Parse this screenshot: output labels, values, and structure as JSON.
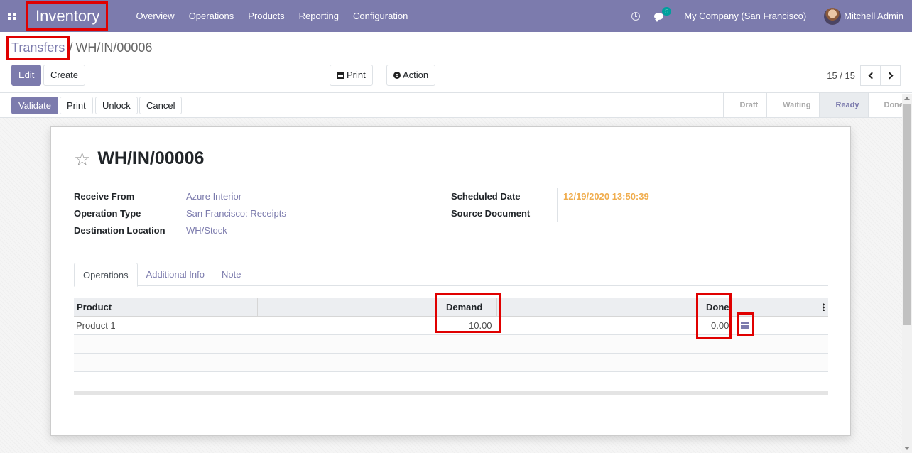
{
  "navbar": {
    "app_title": "Inventory",
    "menu": [
      "Overview",
      "Operations",
      "Products",
      "Reporting",
      "Configuration"
    ],
    "chat_badge": "5",
    "company": "My Company (San Francisco)",
    "user": "Mitchell Admin"
  },
  "breadcrumb": {
    "parent": "Transfers",
    "separator": "/",
    "current": "WH/IN/00006"
  },
  "toolbar": {
    "edit": "Edit",
    "create": "Create",
    "print": "Print",
    "action": "Action"
  },
  "pager": {
    "value": "15 / 15"
  },
  "statusbar": {
    "validate": "Validate",
    "print": "Print",
    "unlock": "Unlock",
    "cancel": "Cancel",
    "stages": [
      "Draft",
      "Waiting",
      "Ready",
      "Done"
    ],
    "active_stage": "Ready"
  },
  "record": {
    "title": "WH/IN/00006",
    "left_fields": [
      {
        "label": "Receive From",
        "value": "Azure Interior"
      },
      {
        "label": "Operation Type",
        "value": "San Francisco: Receipts"
      },
      {
        "label": "Destination Location",
        "value": "WH/Stock"
      }
    ],
    "right_fields": [
      {
        "label": "Scheduled Date",
        "value": "12/19/2020 13:50:39"
      },
      {
        "label": "Source Document",
        "value": ""
      }
    ]
  },
  "tabs": [
    "Operations",
    "Additional Info",
    "Note"
  ],
  "operations_table": {
    "headers": {
      "product": "Product",
      "demand": "Demand",
      "done": "Done"
    },
    "rows": [
      {
        "product": "Product 1",
        "demand": "10.00",
        "done": "0.00"
      }
    ]
  },
  "colors": {
    "brand": "#7c7bad",
    "highlight": "#e00000",
    "date": "#f0ad4e"
  }
}
